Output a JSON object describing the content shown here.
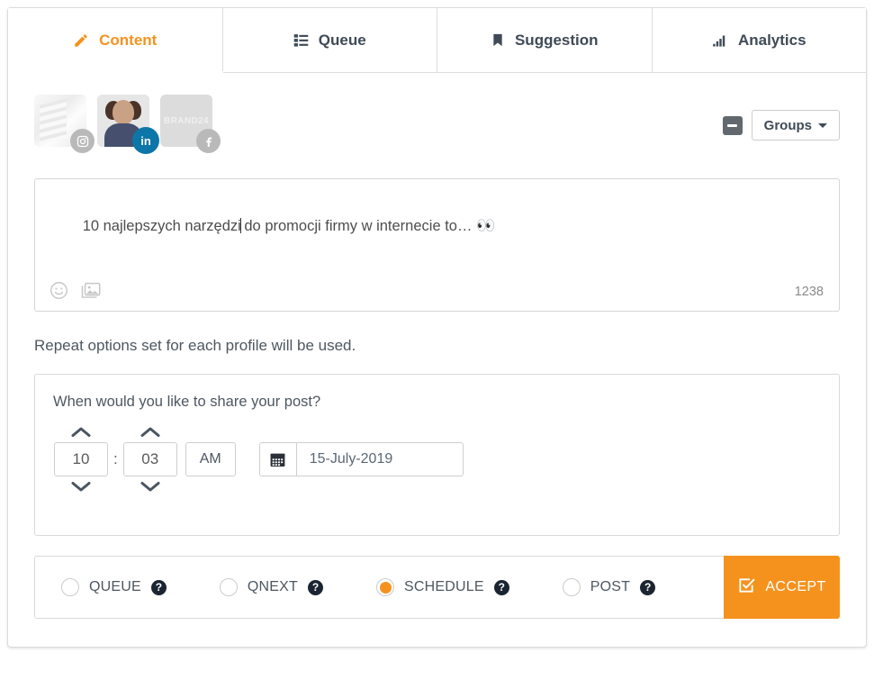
{
  "tabs": [
    {
      "label": "Content",
      "icon": "pencil-icon",
      "active": true
    },
    {
      "label": "Queue",
      "icon": "list-icon",
      "active": false
    },
    {
      "label": "Suggestion",
      "icon": "bookmark-icon",
      "active": false
    },
    {
      "label": "Analytics",
      "icon": "bar-chart-icon",
      "active": false
    }
  ],
  "profiles": [
    {
      "name": "instagram-profile",
      "network": "instagram",
      "selected": false,
      "brand_text": ""
    },
    {
      "name": "linkedin-profile",
      "network": "linkedin",
      "selected": true,
      "brand_text": ""
    },
    {
      "name": "facebook-profile",
      "network": "facebook",
      "selected": false,
      "brand_text": "BRAND24"
    }
  ],
  "toolbar": {
    "collapse_icon": "minus-square-icon",
    "groups_label": "Groups"
  },
  "composer": {
    "text_before_caret": "10 najlepszych narzędzi",
    "text_after_caret": " do promocji firmy w internecie to… ",
    "emoji": "👀",
    "emoji_icon": "smiley-icon",
    "image_icon": "image-icon",
    "char_count": "1238"
  },
  "repeat_note": "Repeat options set for each profile will be used.",
  "schedule": {
    "title": "When would you like to share your post?",
    "hour": "10",
    "separator": ":",
    "minute": "03",
    "meridiem": "AM",
    "date": "15-July-2019",
    "calendar_icon": "calendar-icon",
    "hour_up_icon": "chevron-up-icon",
    "hour_down_icon": "chevron-down-icon",
    "minute_up_icon": "chevron-up-icon",
    "minute_down_icon": "chevron-down-icon"
  },
  "actions": {
    "options": [
      {
        "label": "QUEUE",
        "selected": false,
        "help": "?"
      },
      {
        "label": "QNEXT",
        "selected": false,
        "help": "?"
      },
      {
        "label": "SCHEDULE",
        "selected": true,
        "help": "?"
      },
      {
        "label": "POST",
        "selected": false,
        "help": "?"
      }
    ],
    "accept_label": "ACCEPT",
    "accept_icon": "check-square-icon"
  },
  "colors": {
    "accent_orange": "#f5921e",
    "text_dark": "#3f4a56",
    "linkedin_blue": "#0d76a8",
    "badge_gray": "#b9b9b9",
    "help_dark": "#1b2531"
  }
}
